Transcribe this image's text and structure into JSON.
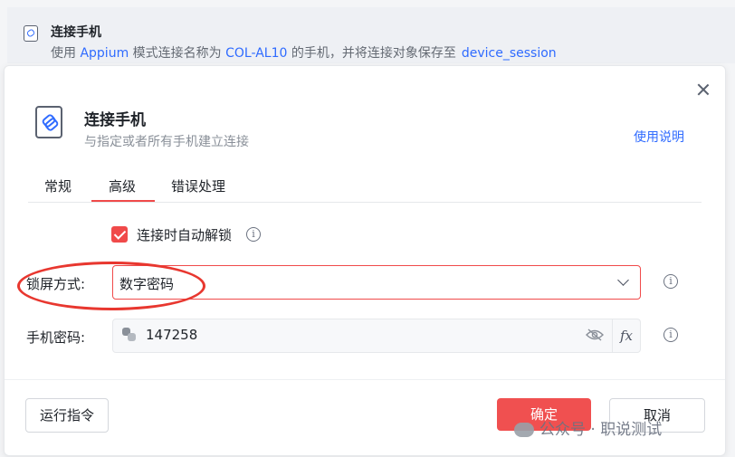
{
  "background_step": {
    "title": "连接手机",
    "desc_prefix": "使用 ",
    "mode": "Appium",
    "desc_mid": " 模式连接名称为 ",
    "device_name": "COL-AL10",
    "desc_suffix": " 的手机，并将连接对象保存至",
    "save_var": "device_session"
  },
  "dialog": {
    "title": "连接手机",
    "subtitle": "与指定或者所有手机建立连接",
    "help_link": "使用说明",
    "tabs": [
      "常规",
      "高级",
      "错误处理"
    ],
    "active_tab": "高级",
    "auto_unlock_label": "连接时自动解锁",
    "auto_unlock_checked": true,
    "lock_method_label": "锁屏方式:",
    "lock_method_value": "数字密码",
    "password_label": "手机密码:",
    "password_value": "147258",
    "fx_label": "fx",
    "run_button": "运行指令",
    "ok_button": "确定",
    "cancel_button": "取消"
  },
  "watermark": {
    "text": "公众号 · 职说测试"
  },
  "colors": {
    "accent_red": "#f04a4a",
    "link_blue": "#2f6bff",
    "annotation_red": "#e8372f"
  }
}
